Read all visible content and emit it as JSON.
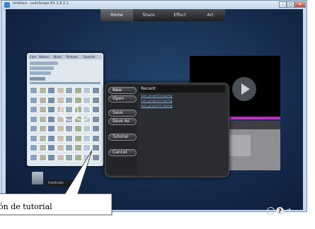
{
  "window": {
    "title": "Untitled - LoiloScope EX 1.8.2.1",
    "min_symbol": "–",
    "max_symbol": "□",
    "close_symbol": "×"
  },
  "topnav": {
    "tabs": [
      {
        "label": "Home"
      },
      {
        "label": "Share"
      },
      {
        "label": "Effect"
      },
      {
        "label": "Art"
      }
    ]
  },
  "library": {
    "tabs": [
      "Cam",
      "Movies",
      "Music",
      "Pictures",
      "Favorite"
    ]
  },
  "menu": {
    "buttons": [
      {
        "label": "New"
      },
      {
        "label": "Open"
      },
      {
        "label": "Save"
      },
      {
        "label": "Save As"
      },
      {
        "label": "Tutorial"
      },
      {
        "label": "Cancel"
      }
    ],
    "recent_header": "Recent",
    "recent_items": [
      "last_project3.lopmg",
      "last_project2.lopmg",
      "last_project1.lopmg"
    ]
  },
  "trash": {
    "label": "trashcan"
  },
  "bottom_icons": {
    "help": "?",
    "arrow": "➜",
    "names": [
      "globe-icon",
      "help-icon",
      "arrow-icon"
    ]
  },
  "callout": {
    "text": "ón de tutorial"
  },
  "colors": {
    "accent_magenta": "#c02ec8",
    "stage_blue": "#1b3358",
    "panel_dark": "#2b2c2f"
  }
}
